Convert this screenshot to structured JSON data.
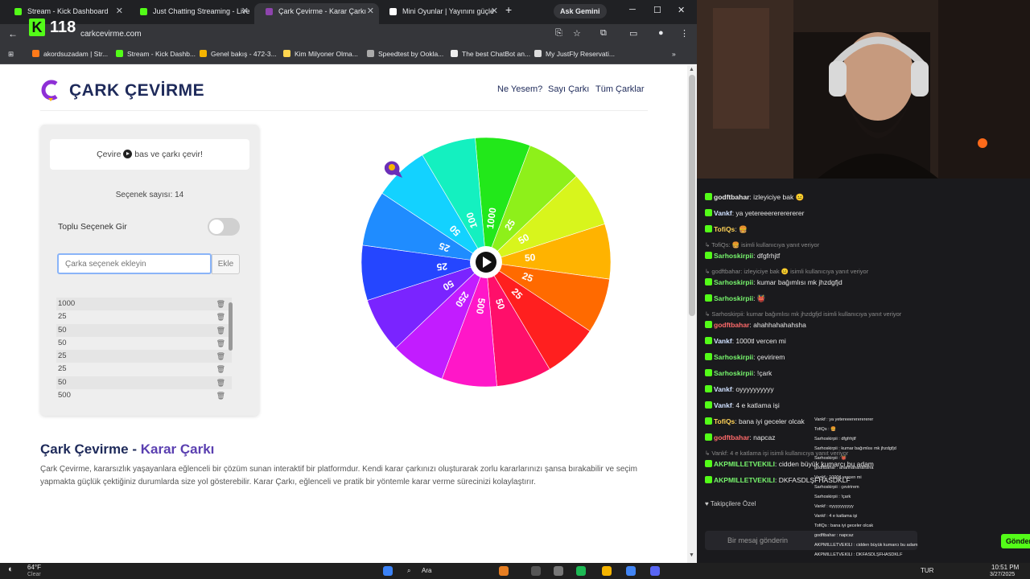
{
  "browser": {
    "tabs": [
      {
        "title": "Stream - Kick Dashboard",
        "fav": "#53fc18"
      },
      {
        "title": "Just Chatting Streaming - Live",
        "fav": "#53fc18"
      },
      {
        "title": "Çark Çevirme - Karar Çarkı",
        "fav": "#8e44ad"
      },
      {
        "title": "Mini Oyunlar | Yayınını güçle",
        "fav": "#ffffff"
      }
    ],
    "gemini_label": "Ask Gemini",
    "url": "carkcevirme.com",
    "bookmarks": [
      "akordsuzadam | Str...",
      "Stream - Kick Dashb...",
      "Genel bakış - 472-3...",
      "Kim Milyoner Olma...",
      "Speedtest by Ookla...",
      "The best ChatBot an...",
      "My JustFly Reservati..."
    ]
  },
  "kick_badge": {
    "letter": "K",
    "count": "118"
  },
  "site": {
    "brand": "ÇARK ÇEVİRME",
    "nav": [
      "Ne Yesem?",
      "Sayı Çarkı",
      "Tüm Çarklar"
    ],
    "hint_pre": "Çevire",
    "hint_post": "bas ve çarkı çevir!",
    "count_label": "Seçenek sayısı: 14",
    "bulk_label": "Toplu Seçenek Gir",
    "input_placeholder": "Çarka seçenek ekleyin",
    "add_label": "Ekle",
    "options": [
      "1000",
      "25",
      "50",
      "50",
      "25",
      "25",
      "50",
      "500"
    ],
    "heading_main": "Çark Çevirme - ",
    "heading_accent": "Karar Çarkı",
    "paragraph": "Çark Çevirme, kararsızlık yaşayanlara eğlenceli bir çözüm sunan interaktif bir platformdur. Kendi karar çarkınızı oluşturarak zorlu kararlarınızı şansa bırakabilir ve seçim yapmakta güçlük çektiğiniz durumlarda size yol gösterebilir. Karar Çarkı, eğlenceli ve pratik bir yöntemle karar verme sürecinizi kolaylaştırır."
  },
  "wheel": {
    "segments": [
      {
        "label": "1000",
        "color": "#22e81a"
      },
      {
        "label": "25",
        "color": "#8ef01a"
      },
      {
        "label": "50",
        "color": "#d8f51c"
      },
      {
        "label": "50",
        "color": "#ffb300"
      },
      {
        "label": "25",
        "color": "#ff6a00"
      },
      {
        "label": "25",
        "color": "#ff1f1f"
      },
      {
        "label": "50",
        "color": "#ff0f6a"
      },
      {
        "label": "500",
        "color": "#ff17c8"
      },
      {
        "label": "250",
        "color": "#c21cff"
      },
      {
        "label": "50",
        "color": "#7a24ff"
      },
      {
        "label": "25",
        "color": "#2546ff"
      },
      {
        "label": "25",
        "color": "#1f8cff"
      },
      {
        "label": "50",
        "color": "#13d2ff"
      },
      {
        "label": "100",
        "color": "#14f0c0"
      }
    ]
  },
  "chat": {
    "messages": [
      {
        "user": "godftbahar",
        "color": "#e8e8e8",
        "text": "izleyiciye bak 😐"
      },
      {
        "user": "Vankf",
        "color": "#cfe0ff",
        "text": "ya yetereeerererererer"
      },
      {
        "user": "TofiQs",
        "color": "#ffd257",
        "text": "🍔"
      },
      {
        "reply": "TofiQs: 🍔 isimli kullanıcıya yanıt veriyor"
      },
      {
        "user": "Sarhoskirpii",
        "color": "#77f56d",
        "text": "dfgfrhjtf"
      },
      {
        "reply": "godftbahar: izleyiciye bak 😐 isimli kullanıcıya yanıt veriyor"
      },
      {
        "user": "Sarhoskirpii",
        "color": "#77f56d",
        "text": "kumar bağımlısı mk jhzdgfjd"
      },
      {
        "user": "Sarhoskirpii",
        "color": "#77f56d",
        "text": "👹"
      },
      {
        "reply": "Sarhoskirpii: kumar bağımlısı mk jhzdgfjd isimli kullanıcıya yanıt veriyor"
      },
      {
        "user": "godftbahar",
        "color": "#ff6a6a",
        "text": "ahahhahahahsha"
      },
      {
        "user": "Vankf",
        "color": "#cfe0ff",
        "text": "1000tl vercen mi"
      },
      {
        "user": "Sarhoskirpii",
        "color": "#77f56d",
        "text": "çevirirem"
      },
      {
        "user": "Sarhoskirpii",
        "color": "#77f56d",
        "text": "!çark"
      },
      {
        "user": "Vankf",
        "color": "#cfe0ff",
        "text": "oyyyyyyyyyy"
      },
      {
        "user": "Vankf",
        "color": "#cfe0ff",
        "text": "4 e katlama işi"
      },
      {
        "user": "TofiQs",
        "color": "#ffd257",
        "text": "bana iyi geceler olcak"
      },
      {
        "user": "godftbahar",
        "color": "#ff6a6a",
        "text": "napcaz"
      },
      {
        "reply": "Vankf: 4 e katlama işi isimli kullanıcıya yanıt veriyor"
      },
      {
        "user": "AKPMILLETVEKILI",
        "color": "#77f56d",
        "text": "cidden büyük kumarcı bu adam"
      },
      {
        "user": "AKPMILLETVEKILI",
        "color": "#77f56d",
        "text": "DKFASDLŞFHASDKLF"
      }
    ],
    "followers_label": "Takipçilere Özel",
    "input_placeholder": "Bir mesaj gönderin",
    "send_label": "Gönder"
  },
  "overlay": {
    "lines": [
      "Vankf : ya yetereeerererererer",
      "TofiQs : 🍔",
      "Sarhoskirpii : dfgfrhjtf",
      "Sarhoskirpii : kumar bağımlısı mk jhzdgfjd",
      "Sarhoskirpii : 👹",
      "godftbahar : ahahhahahahsha",
      "Vankf : 1000tl vercen mi",
      "Sarhoskirpii : çevirirem",
      "Sarhoskirpii : !çark",
      "Vankf : oyyyyyyyyyy",
      "Vankf : 4 e katlama işi",
      "TofiQs : bana iyi geceler olcak",
      "godftbahar : napcaz",
      "AKPMILLETVEKILI : cidden büyük kumarcı bu adam",
      "AKPMILLETVEKILI : DKFASDLŞFHASDKLF"
    ]
  },
  "taskbar": {
    "weather_temp": "64°F",
    "weather_desc": "Clear",
    "search_label": "Ara",
    "lang": "TUR",
    "time": "10:51 PM",
    "date": "3/27/2025"
  }
}
